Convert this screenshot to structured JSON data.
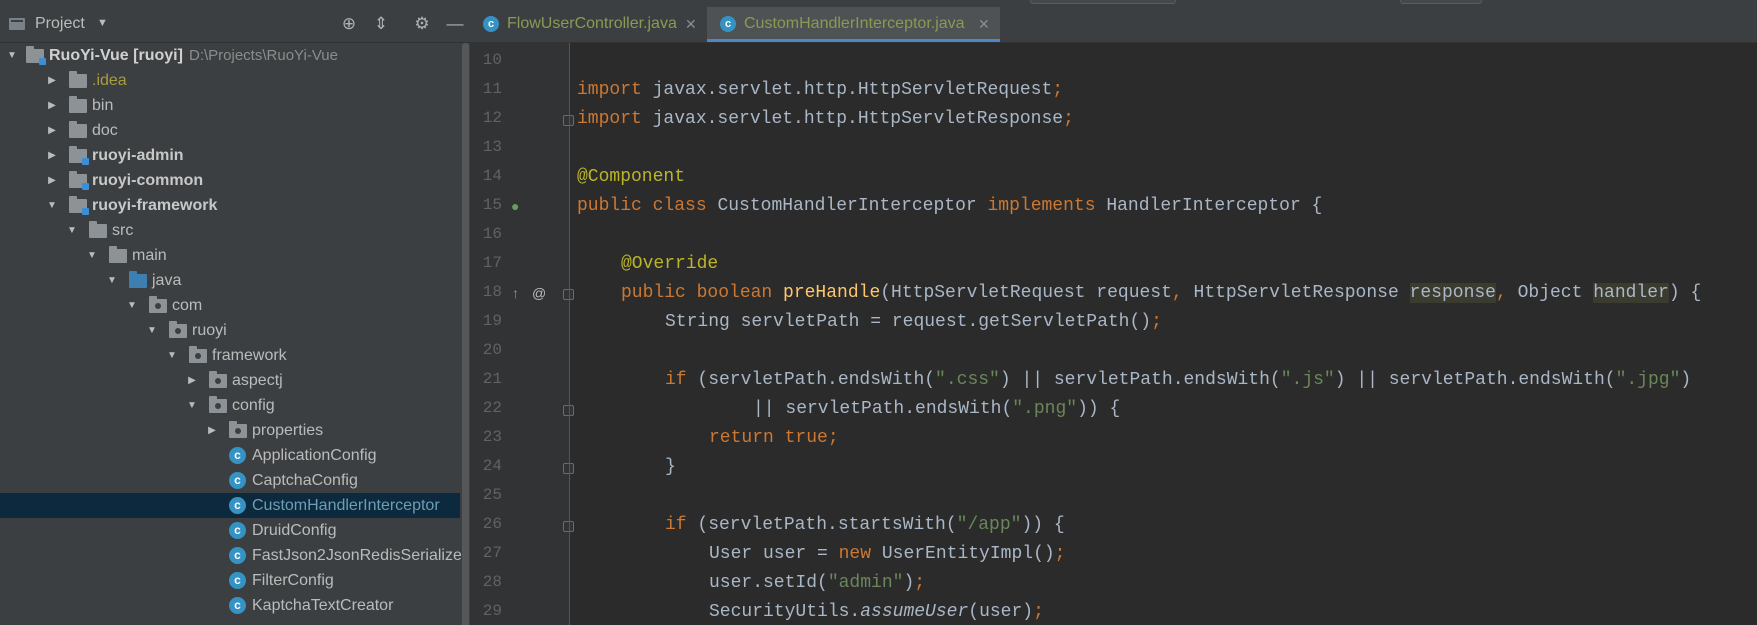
{
  "project_panel": {
    "title": "Project",
    "icons": [
      "project-view-icon",
      "dropdown-caret-icon",
      "locate-icon",
      "collapse-all-icon",
      "gear-icon",
      "minimize-icon"
    ],
    "tree": [
      {
        "label": "RuoYi-Vue [ruoyi]",
        "path": "D:\\Projects\\RuoYi-Vue",
        "depth": 0,
        "arrow": "▼",
        "icon": "folder-module-icon"
      },
      {
        "label": ".idea",
        "depth": 1,
        "arrow": "▶",
        "icon": "folder-icon"
      },
      {
        "label": "bin",
        "depth": 1,
        "arrow": "▶",
        "icon": "folder-icon"
      },
      {
        "label": "doc",
        "depth": 1,
        "arrow": "▶",
        "icon": "folder-icon"
      },
      {
        "label": "ruoyi-admin",
        "depth": 1,
        "arrow": "▶",
        "icon": "folder-module-icon"
      },
      {
        "label": "ruoyi-common",
        "depth": 1,
        "arrow": "▶",
        "icon": "folder-module-icon"
      },
      {
        "label": "ruoyi-framework",
        "depth": 1,
        "arrow": "▼",
        "icon": "folder-module-icon"
      },
      {
        "label": "src",
        "depth": 2,
        "arrow": "▼",
        "icon": "folder-icon"
      },
      {
        "label": "main",
        "depth": 3,
        "arrow": "▼",
        "icon": "folder-icon"
      },
      {
        "label": "java",
        "depth": 4,
        "arrow": "▼",
        "icon": "source-folder-icon"
      },
      {
        "label": "com",
        "depth": 5,
        "arrow": "▼",
        "icon": "package-icon"
      },
      {
        "label": "ruoyi",
        "depth": 6,
        "arrow": "▼",
        "icon": "package-icon"
      },
      {
        "label": "framework",
        "depth": 7,
        "arrow": "▼",
        "icon": "package-icon"
      },
      {
        "label": "aspectj",
        "depth": 8,
        "arrow": "▶",
        "icon": "package-icon"
      },
      {
        "label": "config",
        "depth": 8,
        "arrow": "▼",
        "icon": "package-icon"
      },
      {
        "label": "properties",
        "depth": 9,
        "arrow": "▶",
        "icon": "package-icon"
      },
      {
        "label": "ApplicationConfig",
        "depth": 9,
        "arrow": "",
        "icon": "java-class-icon"
      },
      {
        "label": "CaptchaConfig",
        "depth": 9,
        "arrow": "",
        "icon": "java-class-icon"
      },
      {
        "label": "CustomHandlerInterceptor",
        "depth": 9,
        "arrow": "",
        "icon": "java-class-icon",
        "selected": true
      },
      {
        "label": "DruidConfig",
        "depth": 9,
        "arrow": "",
        "icon": "java-class-icon"
      },
      {
        "label": "FastJson2JsonRedisSerialize",
        "depth": 9,
        "arrow": "",
        "icon": "java-class-icon"
      },
      {
        "label": "FilterConfig",
        "depth": 9,
        "arrow": "",
        "icon": "java-class-icon"
      },
      {
        "label": "KaptchaTextCreator",
        "depth": 9,
        "arrow": "",
        "icon": "java-class-icon"
      }
    ]
  },
  "tabs": [
    {
      "label": "FlowUserController.java",
      "active": false
    },
    {
      "label": "CustomHandlerInterceptor.java",
      "active": true
    }
  ],
  "editor": {
    "lines": [
      {
        "n": "10",
        "indent": 0,
        "tokens": []
      },
      {
        "n": "11",
        "indent": 0,
        "tokens": [
          [
            "kw",
            "import "
          ],
          [
            "",
            "javax.servlet.http.HttpServletRequest"
          ],
          [
            "kw",
            ";"
          ]
        ]
      },
      {
        "n": "12",
        "indent": 0,
        "tokens": [
          [
            "kw",
            "import "
          ],
          [
            "",
            "javax.servlet.http.HttpServletResponse"
          ],
          [
            "kw",
            ";"
          ]
        ]
      },
      {
        "n": "13",
        "indent": 0,
        "tokens": []
      },
      {
        "n": "14",
        "indent": 0,
        "tokens": [
          [
            "an",
            "@Component"
          ]
        ]
      },
      {
        "n": "15",
        "indent": 0,
        "tokens": [
          [
            "kw",
            "public class "
          ],
          [
            "",
            "CustomHandlerInterceptor "
          ],
          [
            "kw",
            "implements "
          ],
          [
            "",
            "HandlerInterceptor {"
          ]
        ]
      },
      {
        "n": "16",
        "indent": 0,
        "tokens": []
      },
      {
        "n": "17",
        "indent": 1,
        "tokens": [
          [
            "an",
            "@Override"
          ]
        ]
      },
      {
        "n": "18",
        "indent": 1,
        "tokens": [
          [
            "kw",
            "public boolean "
          ],
          [
            "fn",
            "preHandle"
          ],
          [
            "",
            "(HttpServletRequest request"
          ],
          [
            "kw",
            ", "
          ],
          [
            "",
            "HttpServletResponse "
          ],
          [
            "hl",
            "response"
          ],
          [
            "kw",
            ", "
          ],
          [
            "",
            "Object "
          ],
          [
            "hl",
            "handler"
          ],
          [
            "",
            ") {"
          ]
        ]
      },
      {
        "n": "19",
        "indent": 2,
        "tokens": [
          [
            "",
            "String servletPath = request.getServletPath()"
          ],
          [
            "kw",
            ";"
          ]
        ]
      },
      {
        "n": "20",
        "indent": 0,
        "tokens": []
      },
      {
        "n": "21",
        "indent": 2,
        "tokens": [
          [
            "kw",
            "if "
          ],
          [
            "",
            "(servletPath.endsWith("
          ],
          [
            "st",
            "\".css\""
          ],
          [
            "",
            ") || servletPath.endsWith("
          ],
          [
            "st",
            "\".js\""
          ],
          [
            "",
            ") || servletPath.endsWith("
          ],
          [
            "st",
            "\".jpg\""
          ],
          [
            "",
            ")"
          ]
        ]
      },
      {
        "n": "22",
        "indent": 4,
        "tokens": [
          [
            "",
            "|| servletPath.endsWith("
          ],
          [
            "st",
            "\".png\""
          ],
          [
            "",
            ")) {"
          ]
        ]
      },
      {
        "n": "23",
        "indent": 3,
        "tokens": [
          [
            "kw",
            "return true;"
          ]
        ]
      },
      {
        "n": "24",
        "indent": 2,
        "tokens": [
          [
            "",
            "}"
          ]
        ]
      },
      {
        "n": "25",
        "indent": 0,
        "tokens": []
      },
      {
        "n": "26",
        "indent": 2,
        "tokens": [
          [
            "kw",
            "if "
          ],
          [
            "",
            "(servletPath.startsWith("
          ],
          [
            "st",
            "\"/app\""
          ],
          [
            "",
            ")) {"
          ]
        ]
      },
      {
        "n": "27",
        "indent": 3,
        "tokens": [
          [
            "",
            "User user = "
          ],
          [
            "kw",
            "new "
          ],
          [
            "",
            "UserEntityImpl()"
          ],
          [
            "kw",
            ";"
          ]
        ]
      },
      {
        "n": "28",
        "indent": 3,
        "tokens": [
          [
            "",
            "user.setId("
          ],
          [
            "st",
            "\"admin\""
          ],
          [
            "",
            ")"
          ],
          [
            "kw",
            ";"
          ]
        ]
      },
      {
        "n": "29",
        "indent": 3,
        "tokens": [
          [
            "",
            "SecurityUtils."
          ],
          [
            "it",
            "assumeUser"
          ],
          [
            "",
            "(user)"
          ],
          [
            "kw",
            ";"
          ]
        ]
      }
    ]
  },
  "colors": {
    "panel_bg": "#3c3f41",
    "editor_bg": "#2b2b2b",
    "gutter_bg": "#313335",
    "keyword": "#cc7832",
    "annotation": "#bbb529",
    "string": "#6a8759",
    "method": "#ffc66d",
    "selection": "#0d293e",
    "tab_accent": "#4a88c7"
  }
}
